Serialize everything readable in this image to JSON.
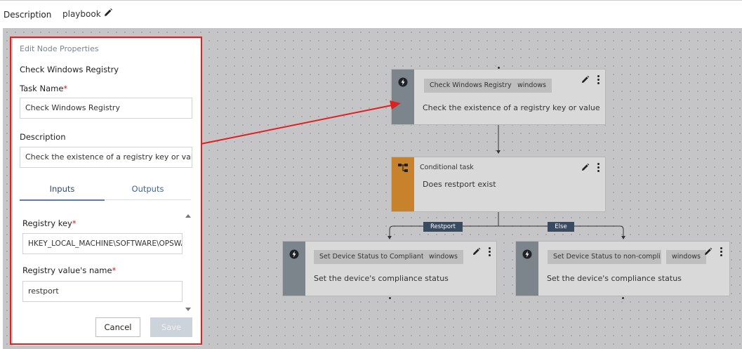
{
  "header": {
    "description_label": "Description",
    "description_value": "playbook"
  },
  "panel": {
    "title": "Edit Node Properties",
    "node_name": "Check Windows Registry",
    "task_name_label": "Task Name",
    "task_name_value": "Check Windows Registry",
    "description_label": "Description",
    "description_value": "Check the existence of a registry key or value",
    "tabs": [
      {
        "label": "Inputs"
      },
      {
        "label": "Outputs"
      }
    ],
    "registry_key_label": "Registry key",
    "registry_key_value": "HKEY_LOCAL_MACHINE\\SOFTWARE\\OPSWAT",
    "registry_value_name_label": "Registry value's name",
    "registry_value_name_value": "restport",
    "required_mark": "*",
    "cancel_label": "Cancel",
    "save_label": "Save"
  },
  "nodes": [
    {
      "chip": "Check Windows Registry",
      "tag": "windows",
      "description": "Check the existence of a registry key or value",
      "icon": "lightning-icon"
    },
    {
      "title": "Conditional task",
      "description": "Does restport exist",
      "icon": "flow-branch-icon"
    },
    {
      "chip": "Set Device Status to Compliant",
      "tag": "windows",
      "description": "Set the device's compliance status",
      "icon": "lightning-icon"
    },
    {
      "chip": "Set Device Status to non-compli...",
      "tag": "windows",
      "description": "Set the device's compliance status",
      "icon": "lightning-icon"
    }
  ],
  "branches": [
    {
      "label": "Restport"
    },
    {
      "label": "Else"
    }
  ],
  "colors": {
    "annotation": "#e02020",
    "orange_strip": "#c9822c",
    "gray_strip": "#7d858c",
    "branch_label": "#3a4a60"
  }
}
